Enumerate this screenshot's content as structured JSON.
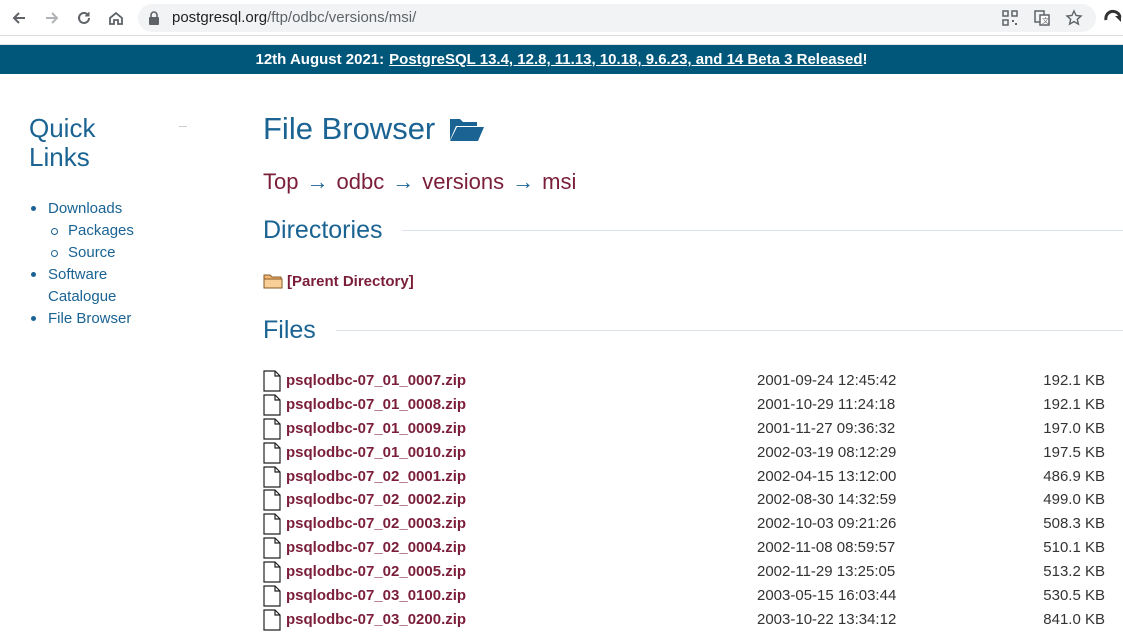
{
  "browser": {
    "url_host": "postgresql.org",
    "url_path": "/ftp/odbc/versions/msi/"
  },
  "banner": {
    "prefix": "12th August 2021:",
    "link": "PostgreSQL 13.4, 12.8, 11.13, 10.18, 9.6.23, and 14 Beta 3 Released",
    "suffix": "!"
  },
  "sidebar": {
    "title_line1": "Quick",
    "title_line2": "Links",
    "items": [
      {
        "label": "Downloads"
      },
      {
        "label": "Packages"
      },
      {
        "label": "Source"
      },
      {
        "label": "Software"
      },
      {
        "label": "Catalogue"
      },
      {
        "label": "File Browser"
      }
    ]
  },
  "main": {
    "title": "File Browser",
    "breadcrumb": [
      "Top",
      "odbc",
      "versions",
      "msi"
    ],
    "arrow": "→",
    "directories_heading": "Directories",
    "parent_dir": "[Parent Directory]",
    "files_heading": "Files",
    "files": [
      {
        "name": "psqlodbc-07_01_0007.zip",
        "date": "2001-09-24 12:45:42",
        "size": "192.1 KB"
      },
      {
        "name": "psqlodbc-07_01_0008.zip",
        "date": "2001-10-29 11:24:18",
        "size": "192.1 KB"
      },
      {
        "name": "psqlodbc-07_01_0009.zip",
        "date": "2001-11-27 09:36:32",
        "size": "197.0 KB"
      },
      {
        "name": "psqlodbc-07_01_0010.zip",
        "date": "2002-03-19 08:12:29",
        "size": "197.5 KB"
      },
      {
        "name": "psqlodbc-07_02_0001.zip",
        "date": "2002-04-15 13:12:00",
        "size": "486.9 KB"
      },
      {
        "name": "psqlodbc-07_02_0002.zip",
        "date": "2002-08-30 14:32:59",
        "size": "499.0 KB"
      },
      {
        "name": "psqlodbc-07_02_0003.zip",
        "date": "2002-10-03 09:21:26",
        "size": "508.3 KB"
      },
      {
        "name": "psqlodbc-07_02_0004.zip",
        "date": "2002-11-08 08:59:57",
        "size": "510.1 KB"
      },
      {
        "name": "psqlodbc-07_02_0005.zip",
        "date": "2002-11-29 13:25:05",
        "size": "513.2 KB"
      },
      {
        "name": "psqlodbc-07_03_0100.zip",
        "date": "2003-05-15 16:03:44",
        "size": "530.5 KB"
      },
      {
        "name": "psqlodbc-07_03_0200.zip",
        "date": "2003-10-22 13:34:12",
        "size": "841.0 KB"
      }
    ]
  },
  "colors": {
    "banner_bg": "#00577a",
    "heading_blue": "#1a6393",
    "link_maroon": "#7b1e3a"
  }
}
